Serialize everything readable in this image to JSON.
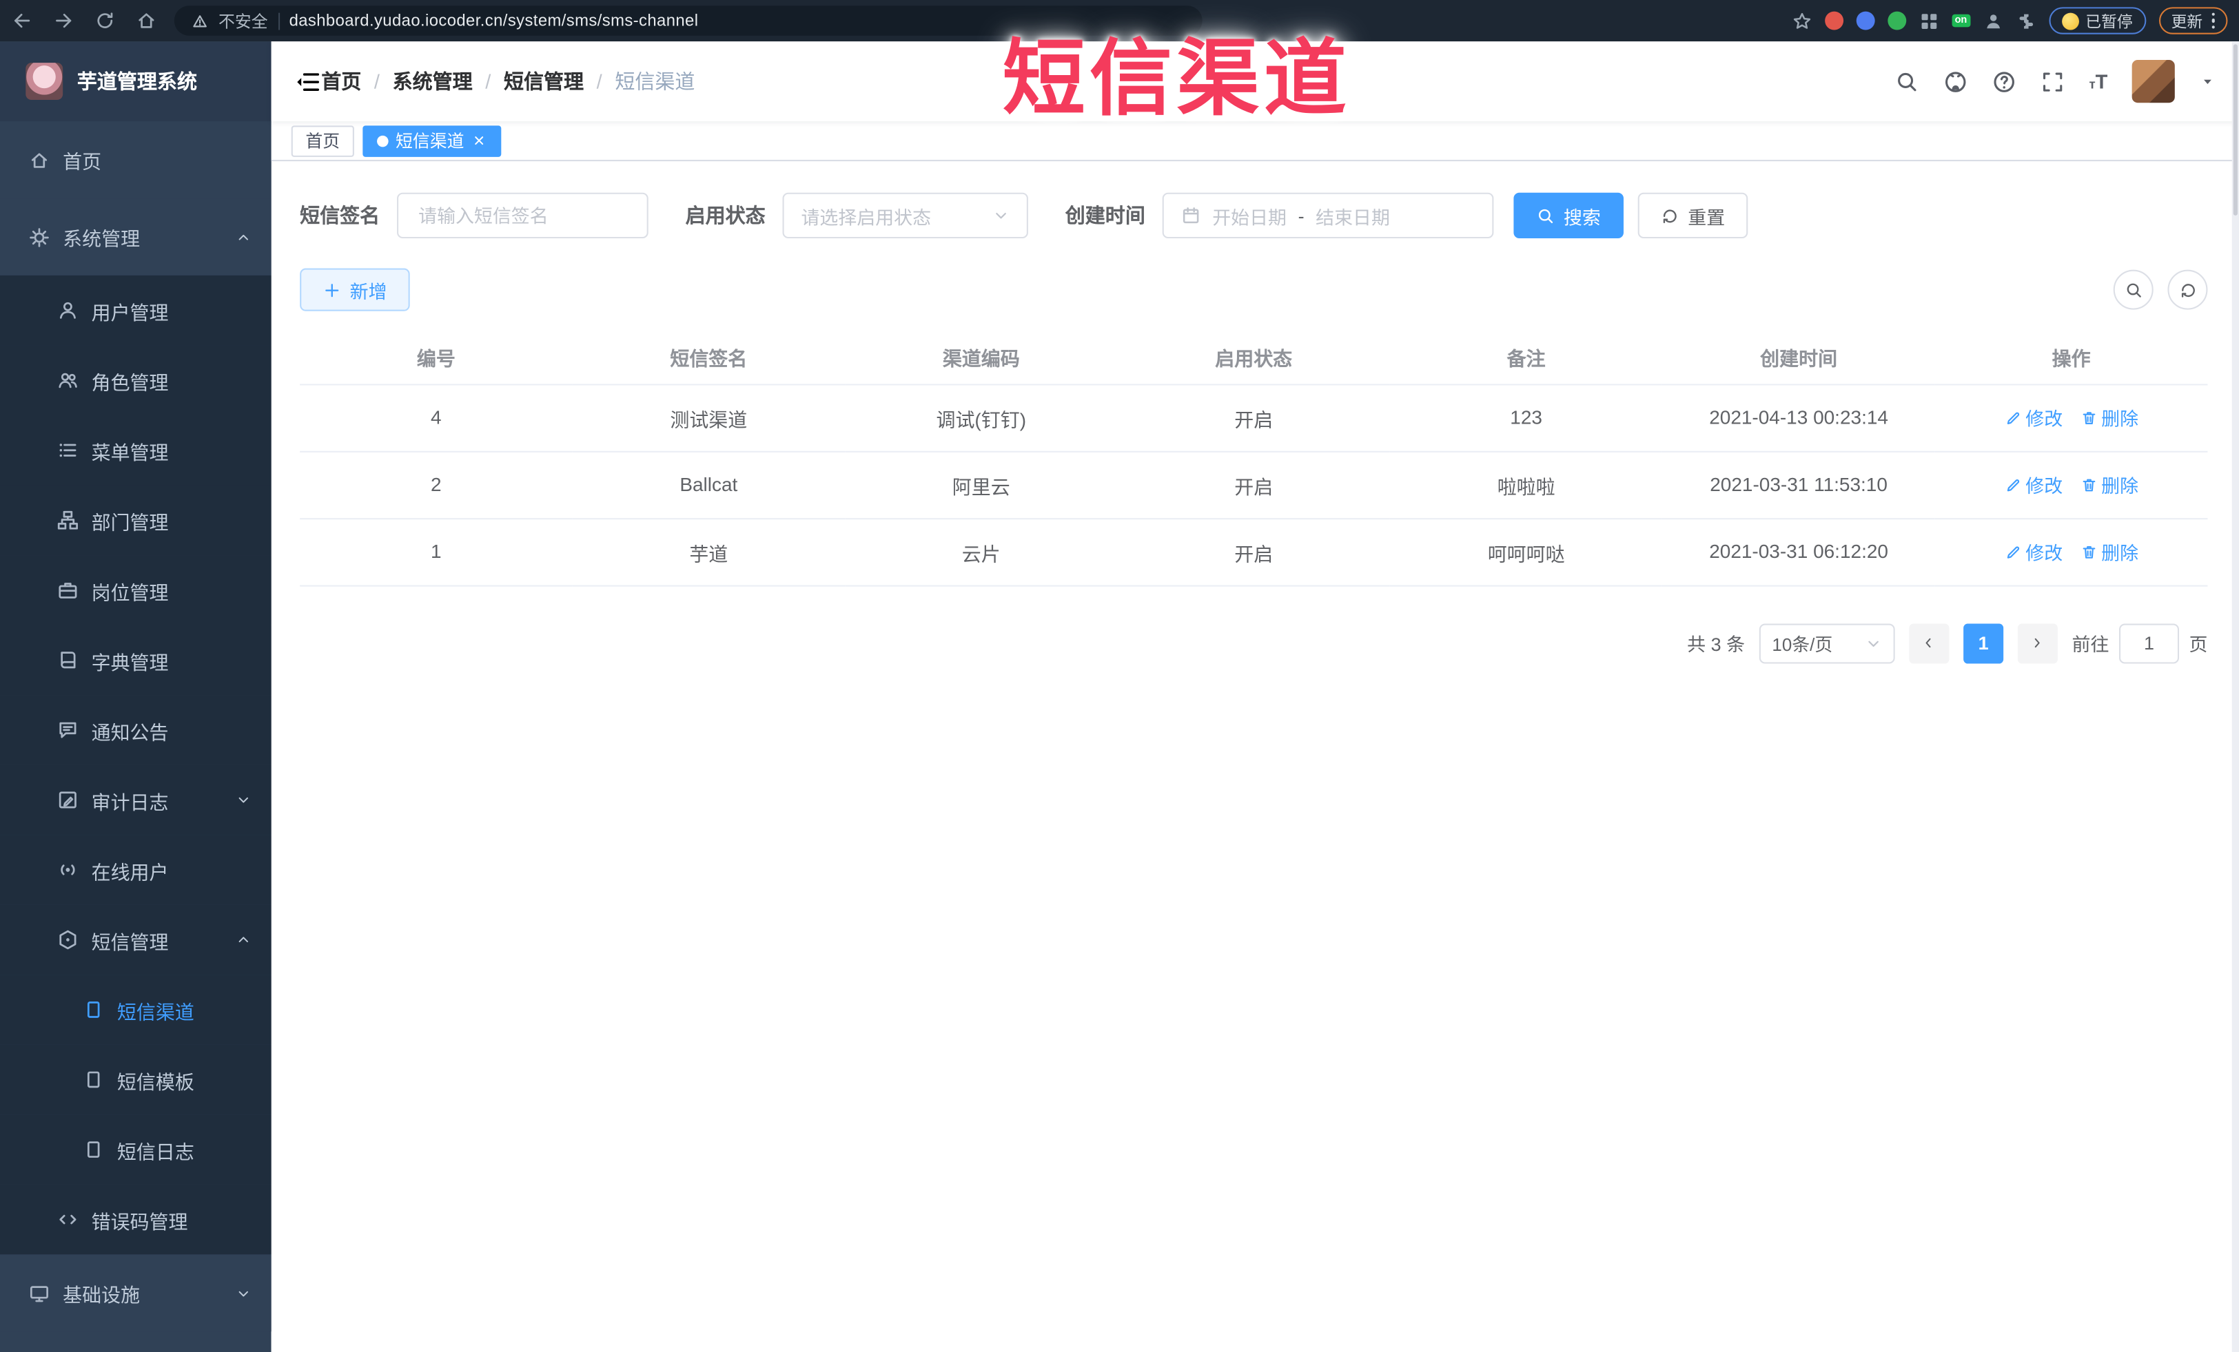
{
  "browser": {
    "security_label": "不安全",
    "url": "dashboard.yudao.iocoder.cn/system/sms/sms-channel",
    "extension_on_badge": "on",
    "paused_badge": "已暂停",
    "update_button": "更新"
  },
  "overlay": {
    "text": "短信渠道",
    "color": "#f43b5c"
  },
  "sidebar": {
    "title": "芋道管理系统",
    "items": [
      {
        "label": "首页",
        "icon": "home-icon",
        "level": 1
      },
      {
        "label": "系统管理",
        "icon": "gear-icon",
        "level": 1,
        "chevron": "up"
      },
      {
        "label": "用户管理",
        "icon": "user-icon",
        "level": 2
      },
      {
        "label": "角色管理",
        "icon": "users-icon",
        "level": 2
      },
      {
        "label": "菜单管理",
        "icon": "list-icon",
        "level": 2
      },
      {
        "label": "部门管理",
        "icon": "tree-icon",
        "level": 2
      },
      {
        "label": "岗位管理",
        "icon": "briefcase-icon",
        "level": 2
      },
      {
        "label": "字典管理",
        "icon": "book-icon",
        "level": 2
      },
      {
        "label": "通知公告",
        "icon": "bubble-icon",
        "level": 2
      },
      {
        "label": "审计日志",
        "icon": "audit-icon",
        "level": 2,
        "chevron": "down"
      },
      {
        "label": "在线用户",
        "icon": "online-icon",
        "level": 2
      },
      {
        "label": "短信管理",
        "icon": "sms-icon",
        "level": 2,
        "chevron": "up"
      },
      {
        "label": "短信渠道",
        "icon": "doc-icon",
        "level": 3,
        "active": true
      },
      {
        "label": "短信模板",
        "icon": "doc-icon",
        "level": 3
      },
      {
        "label": "短信日志",
        "icon": "doc-icon",
        "level": 3
      },
      {
        "label": "错误码管理",
        "icon": "code-icon",
        "level": 2
      },
      {
        "label": "基础设施",
        "icon": "monitor-icon",
        "level": 1,
        "chevron": "down"
      }
    ]
  },
  "breadcrumb": {
    "items": [
      "首页",
      "系统管理",
      "短信管理",
      "短信渠道"
    ]
  },
  "tabs": [
    {
      "label": "首页",
      "active": false
    },
    {
      "label": "短信渠道",
      "active": true,
      "closable": true
    }
  ],
  "filters": {
    "sign_label": "短信签名",
    "sign_placeholder": "请输入短信签名",
    "status_label": "启用状态",
    "status_placeholder": "请选择启用状态",
    "date_label": "创建时间",
    "date_start_placeholder": "开始日期",
    "date_separator": "-",
    "date_end_placeholder": "结束日期",
    "search_label": "搜索",
    "reset_label": "重置"
  },
  "toolbar": {
    "add_label": "新增"
  },
  "table": {
    "headers": [
      "编号",
      "短信签名",
      "渠道编码",
      "启用状态",
      "备注",
      "创建时间",
      "操作"
    ],
    "rows": [
      {
        "id": "4",
        "sign": "测试渠道",
        "code": "调试(钉钉)",
        "status": "开启",
        "remark": "123",
        "created": "2021-04-13 00:23:14"
      },
      {
        "id": "2",
        "sign": "Ballcat",
        "code": "阿里云",
        "status": "开启",
        "remark": "啦啦啦",
        "created": "2021-03-31 11:53:10"
      },
      {
        "id": "1",
        "sign": "芋道",
        "code": "云片",
        "status": "开启",
        "remark": "呵呵呵哒",
        "created": "2021-03-31 06:12:20"
      }
    ],
    "edit_label": "修改",
    "delete_label": "删除"
  },
  "pagination": {
    "total_label": "共 3 条",
    "page_size_label": "10条/页",
    "current_page": "1",
    "goto_label": "前往",
    "goto_value": "1",
    "page_unit_label": "页"
  },
  "colors": {
    "accent": "#409eff",
    "sidebar_bg": "#304156",
    "submenu_bg": "#1f2d3d",
    "overlay_red": "#f43b5c"
  }
}
